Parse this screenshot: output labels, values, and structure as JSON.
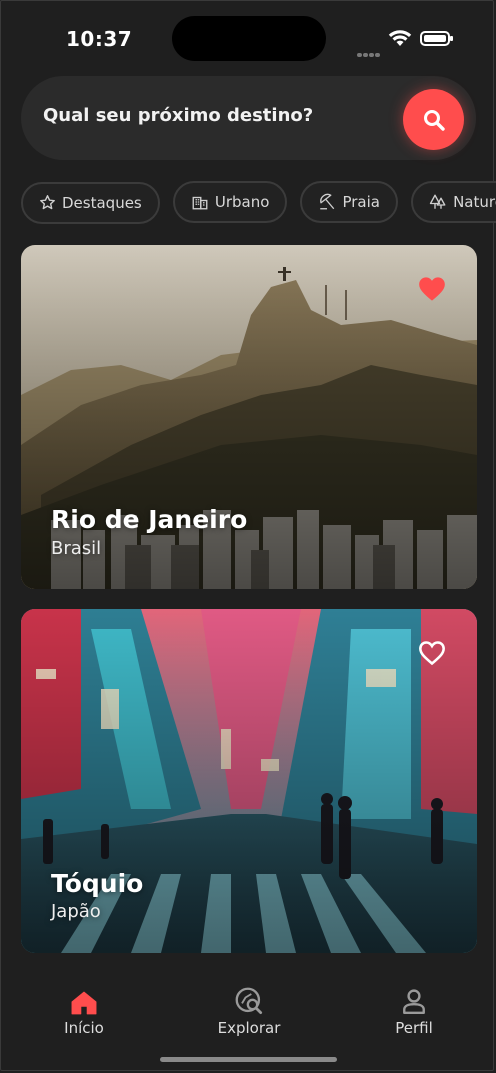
{
  "status_bar": {
    "time": "10:37"
  },
  "search": {
    "label": "Qual seu próximo destino?",
    "button_icon": "search-icon"
  },
  "chips": [
    {
      "label": "Destaques",
      "icon": "star-icon"
    },
    {
      "label": "Urbano",
      "icon": "building-icon"
    },
    {
      "label": "Praia",
      "icon": "beach-icon"
    },
    {
      "label": "Naturez",
      "icon": "trees-icon"
    }
  ],
  "cards": [
    {
      "title": "Rio de Janeiro",
      "subtitle": "Brasil",
      "favorite": true
    },
    {
      "title": "Tóquio",
      "subtitle": "Japão",
      "favorite": false
    }
  ],
  "nav": {
    "home": "Início",
    "explore": "Explorar",
    "profile": "Perfil"
  },
  "colors": {
    "accent": "#ff4d4d",
    "background": "#1f1f1f",
    "surface": "#2b2b2b"
  }
}
